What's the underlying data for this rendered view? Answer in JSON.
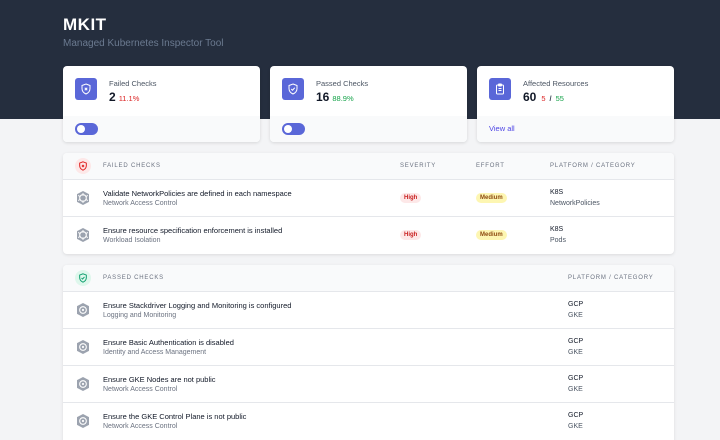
{
  "app": {
    "title": "MKIT",
    "subtitle": "Managed Kubernetes Inspector Tool"
  },
  "cards": {
    "failed": {
      "label": "Failed Checks",
      "value": "2",
      "pct": "11.1%",
      "icon": "shield-x-icon"
    },
    "passed": {
      "label": "Passed Checks",
      "value": "16",
      "pct": "88.9%",
      "icon": "shield-check-icon"
    },
    "affected": {
      "label": "Affected Resources",
      "value": "60",
      "failed_count": "5",
      "separator": "/",
      "passed_count": "55",
      "link": "View all",
      "icon": "clipboard-icon"
    }
  },
  "failed_section": {
    "title": "FAILED CHECKS",
    "columns": {
      "severity": "SEVERITY",
      "effort": "EFFORT",
      "platform": "PLATFORM / CATEGORY"
    },
    "rows": [
      {
        "name": "Validate NetworkPolicies are defined in each namespace",
        "category": "Network Access Control",
        "severity": "High",
        "effort": "Medium",
        "platform": "K8S",
        "platform_category": "NetworkPolicies"
      },
      {
        "name": "Ensure resource specification enforcement is installed",
        "category": "Workload Isolation",
        "severity": "High",
        "effort": "Medium",
        "platform": "K8S",
        "platform_category": "Pods"
      }
    ]
  },
  "passed_section": {
    "title": "PASSED CHECKS",
    "columns": {
      "platform": "PLATFORM / CATEGORY"
    },
    "rows": [
      {
        "name": "Ensure Stackdriver Logging and Monitoring is configured",
        "category": "Logging and Monitoring",
        "platform": "GCP",
        "platform_category": "GKE"
      },
      {
        "name": "Ensure Basic Authentication is disabled",
        "category": "Identity and Access Management",
        "platform": "GCP",
        "platform_category": "GKE"
      },
      {
        "name": "Ensure GKE Nodes are not public",
        "category": "Network Access Control",
        "platform": "GCP",
        "platform_category": "GKE"
      },
      {
        "name": "Ensure the GKE Control Plane is not public",
        "category": "Network Access Control",
        "platform": "GCP",
        "platform_category": "GKE"
      }
    ]
  },
  "colors": {
    "header_bg": "#252e3e",
    "accent": "#5a67d8",
    "high": "#c81e1e",
    "medium": "#8e4b10",
    "fail": "#dc2626",
    "pass": "#16a34a"
  }
}
